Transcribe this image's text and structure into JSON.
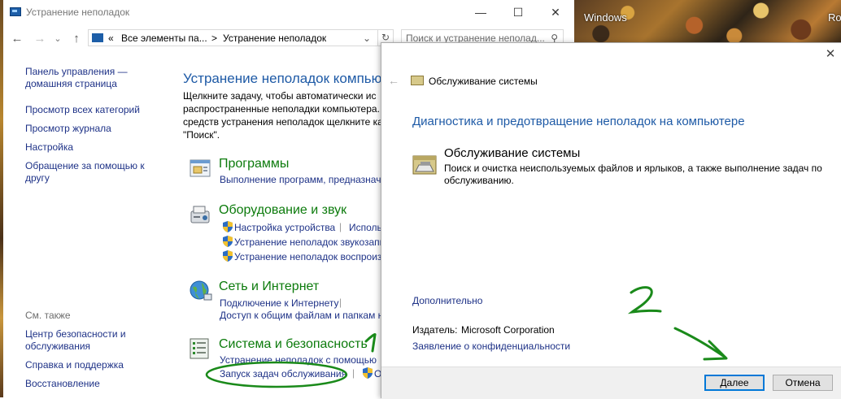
{
  "desktop": {
    "wallpaper_texts": [
      "Windows",
      "Ro"
    ]
  },
  "control_panel": {
    "title": "Устранение неполадок",
    "window_buttons": [
      "—",
      "☐",
      "✕"
    ],
    "address": {
      "prefix": "«",
      "crumb1": "Все элементы па...",
      "sep": ">",
      "crumb2": "Устранение неполадок"
    },
    "search_placeholder": "Поиск и устранение неполад...",
    "left_nav": {
      "home": [
        "Панель управления —",
        "домашняя страница"
      ],
      "items": [
        "Просмотр всех категорий",
        "Просмотр журнала",
        "Настройка"
      ],
      "help_contact": [
        "Обращение за помощью к",
        "другу"
      ],
      "see_also": "См. также",
      "see_also_items": {
        "security": [
          "Центр безопасности и",
          "обслуживания"
        ],
        "support": "Справка и поддержка",
        "recovery": "Восстановление"
      }
    },
    "main": {
      "title": "Устранение неполадок компьютер",
      "desc": [
        "Щелкните задачу, чтобы автоматически ис",
        "распространенные неполадки компьютера.",
        "средств устранения неполадок щелкните ка",
        "\"Поиск\"."
      ],
      "categories": {
        "programs": {
          "title": "Программы",
          "links": [
            "Выполнение программ, предназнач"
          ]
        },
        "hardware": {
          "title": "Оборудование и звук",
          "links": [
            "Настройка устройства",
            "Использ",
            "Устранение неполадок звукозапи",
            "Устранение неполадок воспроиз"
          ]
        },
        "network": {
          "title": "Сеть и Интернет",
          "links": [
            "Подключение к Интернету",
            "Доступ к общим файлам и папкам н"
          ]
        },
        "system": {
          "title": "Система и безопасность",
          "links": [
            "Устранение неполадок с помощью",
            "Запуск задач обслуживания",
            "О"
          ]
        }
      }
    }
  },
  "dialog": {
    "header_title": "Обслуживание системы",
    "heading": "Диагностика и предотвращение неполадок на компьютере",
    "item_title": "Обслуживание системы",
    "item_desc": "Поиск и очистка неиспользуемых файлов и ярлыков, а также выполнение задач по обслуживанию.",
    "more_link": "Дополнительно",
    "publisher_label": "Издатель:",
    "publisher_value": "Microsoft Corporation",
    "privacy_link": "Заявление о конфиденциальности",
    "next_button": "Далее",
    "cancel_button": "Отмена",
    "close": "✕"
  },
  "annotations": {
    "step1": "1",
    "step2": "2",
    "color": "#1a8a1a"
  },
  "colors": {
    "link": "#1e3287",
    "heading": "#1e5aa6",
    "category_title": "#0c7b0c",
    "button_focus": "#0078d7"
  }
}
